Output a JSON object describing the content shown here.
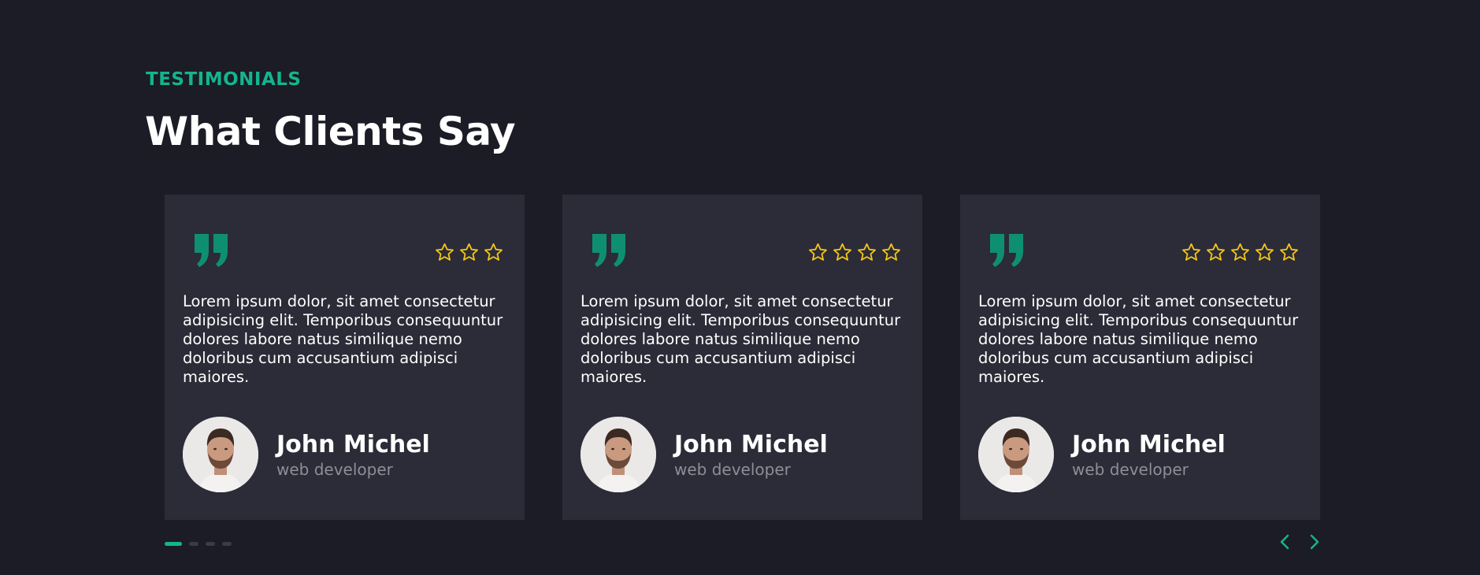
{
  "section": {
    "eyebrow": "TESTIMONIALS",
    "title": "What Clients Say"
  },
  "colors": {
    "background": "#1b1c25",
    "card": "#2b2c37",
    "accent": "#14b48e",
    "quote": "#0f8f72",
    "star": "#f5c518",
    "muted_text": "#8d8e97"
  },
  "testimonials": [
    {
      "rating": 3,
      "text": "Lorem ipsum dolor, sit amet consectetur adipisicing elit. Temporibus consequuntur dolores labore natus similique nemo doloribus cum accusantium adipisci maiores.",
      "name": "John Michel",
      "role": "web developer"
    },
    {
      "rating": 4,
      "text": "Lorem ipsum dolor, sit amet consectetur adipisicing elit. Temporibus consequuntur dolores labore natus similique nemo doloribus cum accusantium adipisci maiores.",
      "name": "John Michel",
      "role": "web developer"
    },
    {
      "rating": 5,
      "text": "Lorem ipsum dolor, sit amet consectetur adipisicing elit. Temporibus consequuntur dolores labore natus similique nemo doloribus cum accusantium adipisci maiores.",
      "name": "John Michel",
      "role": "web developer"
    }
  ],
  "pagination": {
    "pages": 4,
    "active": 0
  },
  "icons": {
    "quote": "quote-icon",
    "star": "star-outline-icon",
    "prev": "chevron-left-icon",
    "next": "chevron-right-icon"
  }
}
